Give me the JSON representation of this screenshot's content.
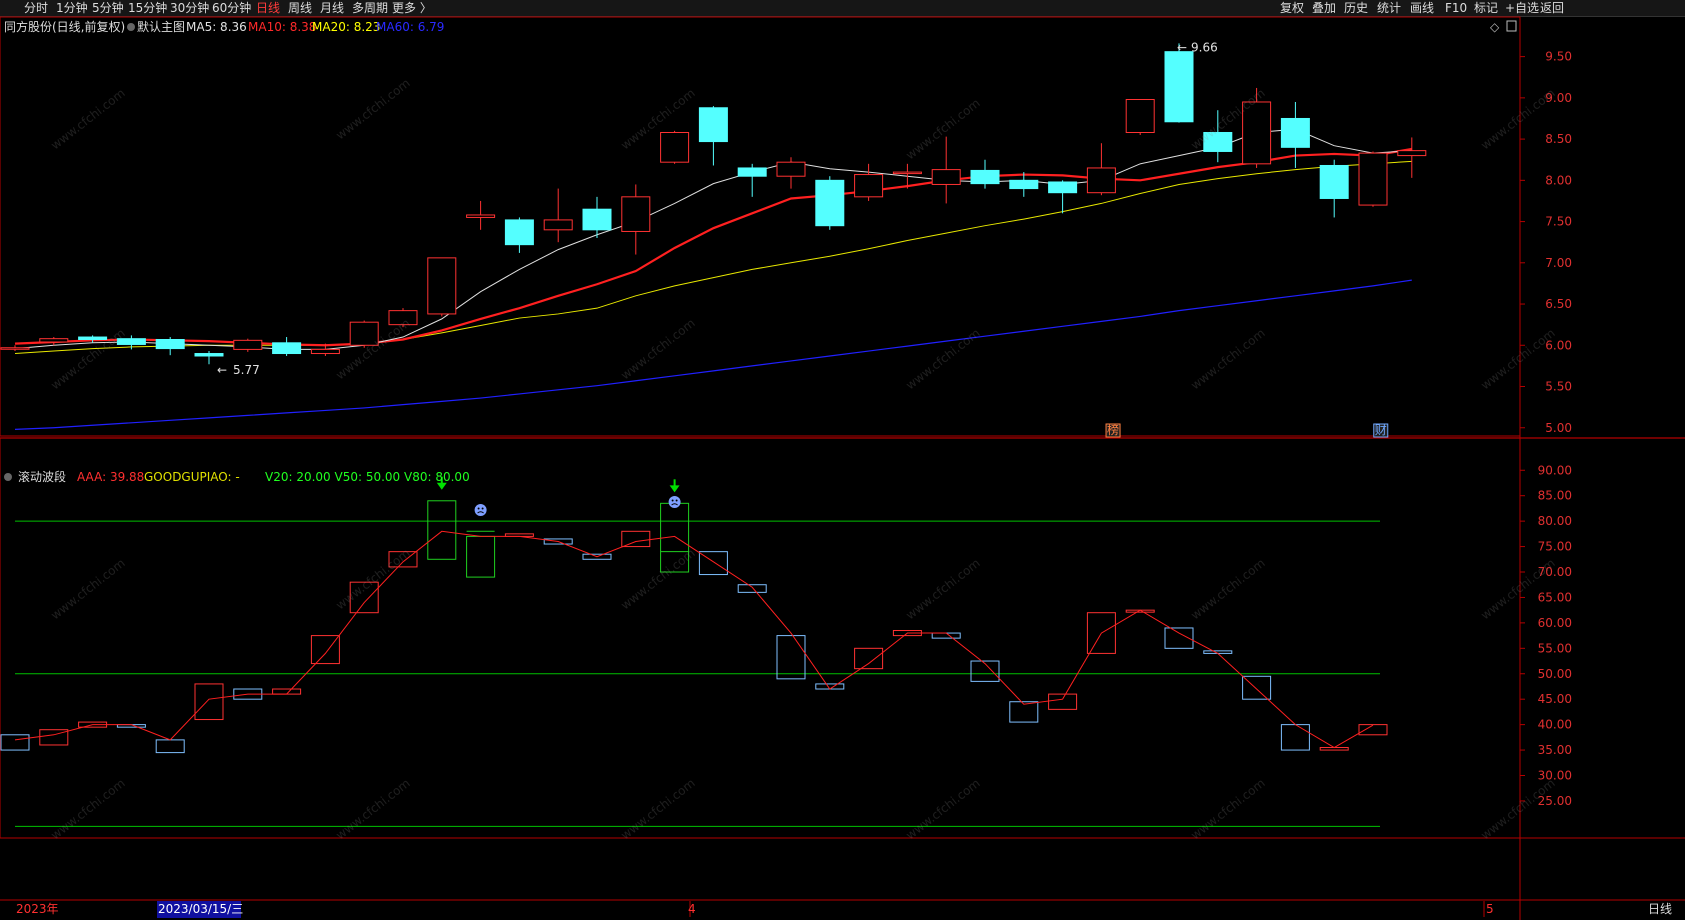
{
  "toolbar": {
    "left": [
      "分时",
      "1分钟",
      "5分钟",
      "15分钟",
      "30分钟",
      "60分钟",
      "日线",
      "周线",
      "月线",
      "多周期",
      "更多 〉"
    ],
    "active": "日线",
    "right": [
      "复权",
      "叠加",
      "历史",
      "统计",
      "画线",
      "F10",
      "+自选",
      "返回"
    ],
    "mark_label": "标记"
  },
  "main_legend": {
    "stock": "同方股份(日线,前复权)",
    "template": "默认主图",
    "ma5": "MA5: 8.36",
    "ma10": "MA10: 8.38",
    "ma20": "MA20: 8.23",
    "ma60": "MA60: 6.79"
  },
  "sub_legend": {
    "name": "滚动波段",
    "aaa": "AAA: 39.88",
    "goodgupiao": "GOODGUPIAO: -",
    "v": "V20: 20.00  V50: 50.00  V80: 80.00"
  },
  "annotations": {
    "high": "9.66",
    "low": "5.77",
    "event1": "榜",
    "event2": "财"
  },
  "bottom": {
    "year": "2023年",
    "cursor_date": "2023/03/15/三",
    "month4": "4",
    "month5": "5",
    "period": "日线"
  },
  "watermark": "www.cfchi.com",
  "colors": {
    "bg": "#000000",
    "up": "#ff3232",
    "down": "#54ffff",
    "ma5": "#e0e0e0",
    "ma10": "#ff2020",
    "ma20": "#e8e800",
    "ma60": "#2020ff",
    "axis": "#b40000",
    "green": "#00c000",
    "sub_down": "#7fbfff"
  },
  "chart_data": [
    {
      "type": "candlestick",
      "title": "同方股份(日线,前复权)",
      "ylim": [
        4.9,
        9.75
      ],
      "yticks": [
        5.0,
        5.5,
        6.0,
        6.5,
        7.0,
        7.5,
        8.0,
        8.5,
        9.0,
        9.5
      ],
      "candles": [
        {
          "o": 5.97,
          "c": 5.97,
          "h": 6.0,
          "l": 5.93
        },
        {
          "o": 6.04,
          "c": 6.08,
          "h": 6.1,
          "l": 6.0
        },
        {
          "o": 6.1,
          "c": 6.07,
          "h": 6.12,
          "l": 6.03
        },
        {
          "o": 6.08,
          "c": 6.01,
          "h": 6.12,
          "l": 5.95
        },
        {
          "o": 6.07,
          "c": 5.96,
          "h": 6.1,
          "l": 5.88
        },
        {
          "o": 5.9,
          "c": 5.87,
          "h": 5.93,
          "l": 5.77
        },
        {
          "o": 5.95,
          "c": 6.06,
          "h": 6.08,
          "l": 5.92
        },
        {
          "o": 6.03,
          "c": 5.9,
          "h": 6.1,
          "l": 5.87
        },
        {
          "o": 5.9,
          "c": 5.95,
          "h": 6.02,
          "l": 5.87
        },
        {
          "o": 6.0,
          "c": 6.28,
          "h": 6.3,
          "l": 5.97
        },
        {
          "o": 6.25,
          "c": 6.42,
          "h": 6.45,
          "l": 6.22
        },
        {
          "o": 6.38,
          "c": 7.06,
          "h": 7.06,
          "l": 6.35
        },
        {
          "o": 7.55,
          "c": 7.58,
          "h": 7.75,
          "l": 7.4
        },
        {
          "o": 7.52,
          "c": 7.22,
          "h": 7.55,
          "l": 7.12
        },
        {
          "o": 7.4,
          "c": 7.52,
          "h": 7.9,
          "l": 7.25
        },
        {
          "o": 7.65,
          "c": 7.4,
          "h": 7.8,
          "l": 7.3
        },
        {
          "o": 7.38,
          "c": 7.8,
          "h": 7.95,
          "l": 7.1
        },
        {
          "o": 8.22,
          "c": 8.58,
          "h": 8.6,
          "l": 8.2
        },
        {
          "o": 8.88,
          "c": 8.47,
          "h": 8.9,
          "l": 8.18
        },
        {
          "o": 8.15,
          "c": 8.05,
          "h": 8.2,
          "l": 7.8
        },
        {
          "o": 8.05,
          "c": 8.22,
          "h": 8.28,
          "l": 7.9
        },
        {
          "o": 8.0,
          "c": 7.45,
          "h": 8.05,
          "l": 7.4
        },
        {
          "o": 7.8,
          "c": 8.07,
          "h": 8.2,
          "l": 7.75
        },
        {
          "o": 8.1,
          "c": 8.1,
          "h": 8.2,
          "l": 7.9
        },
        {
          "o": 7.95,
          "c": 8.13,
          "h": 8.53,
          "l": 7.72
        },
        {
          "o": 8.12,
          "c": 7.96,
          "h": 8.25,
          "l": 7.9
        },
        {
          "o": 8.0,
          "c": 7.9,
          "h": 8.1,
          "l": 7.8
        },
        {
          "o": 7.98,
          "c": 7.85,
          "h": 8.0,
          "l": 7.6
        },
        {
          "o": 7.85,
          "c": 8.15,
          "h": 8.45,
          "l": 7.82
        },
        {
          "o": 8.58,
          "c": 8.98,
          "h": 8.98,
          "l": 8.55
        },
        {
          "o": 9.56,
          "c": 8.71,
          "h": 9.66,
          "l": 8.7
        },
        {
          "o": 8.58,
          "c": 8.35,
          "h": 8.85,
          "l": 8.22
        },
        {
          "o": 8.2,
          "c": 8.95,
          "h": 9.12,
          "l": 8.15
        },
        {
          "o": 8.75,
          "c": 8.4,
          "h": 8.95,
          "l": 8.15
        },
        {
          "o": 8.18,
          "c": 7.78,
          "h": 8.25,
          "l": 7.55
        },
        {
          "o": 7.7,
          "c": 8.33,
          "h": 8.35,
          "l": 7.68
        },
        {
          "o": 8.3,
          "c": 8.36,
          "h": 8.52,
          "l": 8.03
        }
      ],
      "ma5": [
        5.96,
        6.0,
        6.03,
        6.04,
        6.02,
        6.0,
        5.98,
        5.95,
        5.95,
        6.0,
        6.1,
        6.32,
        6.65,
        6.92,
        7.16,
        7.34,
        7.5,
        7.72,
        7.96,
        8.1,
        8.22,
        8.14,
        8.1,
        8.05,
        8.0,
        7.98,
        8.0,
        7.95,
        8.0,
        8.2,
        8.3,
        8.4,
        8.58,
        8.62,
        8.42,
        8.33,
        8.36
      ],
      "ma10": [
        6.02,
        6.04,
        6.06,
        6.07,
        6.06,
        6.05,
        6.03,
        6.01,
        6.0,
        6.02,
        6.07,
        6.18,
        6.32,
        6.45,
        6.6,
        6.74,
        6.9,
        7.18,
        7.42,
        7.6,
        7.78,
        7.82,
        7.87,
        7.93,
        8.0,
        8.05,
        8.07,
        8.06,
        8.02,
        8.0,
        8.08,
        8.16,
        8.22,
        8.3,
        8.32,
        8.3,
        8.38
      ],
      "ma20": [
        5.9,
        5.93,
        5.96,
        5.98,
        5.99,
        6.0,
        6.0,
        6.0,
        6.0,
        6.02,
        6.07,
        6.15,
        6.24,
        6.33,
        6.38,
        6.45,
        6.6,
        6.72,
        6.82,
        6.92,
        7.0,
        7.08,
        7.17,
        7.27,
        7.36,
        7.45,
        7.53,
        7.62,
        7.72,
        7.84,
        7.95,
        8.02,
        8.08,
        8.13,
        8.17,
        8.2,
        8.23
      ],
      "ma60": [
        4.98,
        5.0,
        5.03,
        5.06,
        5.09,
        5.12,
        5.15,
        5.18,
        5.21,
        5.24,
        5.28,
        5.32,
        5.36,
        5.41,
        5.46,
        5.51,
        5.57,
        5.63,
        5.69,
        5.75,
        5.81,
        5.87,
        5.93,
        5.99,
        6.05,
        6.11,
        6.17,
        6.23,
        6.29,
        6.35,
        6.42,
        6.48,
        6.54,
        6.6,
        6.66,
        6.72,
        6.79
      ]
    },
    {
      "type": "candlestick",
      "title": "滚动波段",
      "ylim": [
        18.5,
        93.0
      ],
      "yticks": [
        25,
        30,
        35,
        40,
        45,
        50,
        55,
        60,
        65,
        70,
        75,
        80,
        85,
        90
      ],
      "hlines": [
        20,
        50,
        80
      ],
      "bars": [
        {
          "o": 38.0,
          "c": 35.0,
          "k": "down"
        },
        {
          "o": 36.0,
          "c": 39.0,
          "k": "up"
        },
        {
          "o": 39.5,
          "c": 40.5,
          "k": "up"
        },
        {
          "o": 40.0,
          "c": 39.5,
          "k": "down"
        },
        {
          "o": 37.0,
          "c": 34.5,
          "k": "down"
        },
        {
          "o": 41.0,
          "c": 48.0,
          "k": "up"
        },
        {
          "o": 47.0,
          "c": 45.0,
          "k": "down"
        },
        {
          "o": 46.0,
          "c": 47.0,
          "k": "up"
        },
        {
          "o": 52.0,
          "c": 57.5,
          "k": "up"
        },
        {
          "o": 62.0,
          "c": 68.0,
          "k": "up"
        },
        {
          "o": 71.0,
          "c": 74.0,
          "k": "up"
        },
        {
          "o": 72.5,
          "c": 84.0,
          "k": "green"
        },
        {
          "o": 77.0,
          "c": 69.0,
          "k": "green",
          "mark": 78.0
        },
        {
          "o": 77.0,
          "c": 77.5,
          "k": "up"
        },
        {
          "o": 76.5,
          "c": 75.5,
          "k": "down"
        },
        {
          "o": 73.5,
          "c": 72.5,
          "k": "down"
        },
        {
          "o": 75.0,
          "c": 78.0,
          "k": "up"
        },
        {
          "o": 70.0,
          "c": 83.5,
          "k": "green",
          "mark": 74.0
        },
        {
          "o": 74.0,
          "c": 69.5,
          "k": "down"
        },
        {
          "o": 67.5,
          "c": 66.0,
          "k": "down"
        },
        {
          "o": 57.5,
          "c": 49.0,
          "k": "down"
        },
        {
          "o": 48.0,
          "c": 47.0,
          "k": "down"
        },
        {
          "o": 51.0,
          "c": 55.0,
          "k": "up"
        },
        {
          "o": 57.5,
          "c": 58.5,
          "k": "up"
        },
        {
          "o": 58.0,
          "c": 57.0,
          "k": "down"
        },
        {
          "o": 52.5,
          "c": 48.5,
          "k": "down"
        },
        {
          "o": 44.5,
          "c": 40.5,
          "k": "down"
        },
        {
          "o": 43.0,
          "c": 46.0,
          "k": "up"
        },
        {
          "o": 54.0,
          "c": 62.0,
          "k": "up"
        },
        {
          "o": 62.5,
          "c": 62.5,
          "k": "up"
        },
        {
          "o": 59.0,
          "c": 55.0,
          "k": "down"
        },
        {
          "o": 54.5,
          "c": 54.0,
          "k": "down"
        },
        {
          "o": 49.5,
          "c": 45.0,
          "k": "down"
        },
        {
          "o": 40.0,
          "c": 35.0,
          "k": "down"
        },
        {
          "o": 35.0,
          "c": 35.5,
          "k": "up"
        },
        {
          "o": 38.0,
          "c": 40.0,
          "k": "up"
        }
      ],
      "aaa_line": [
        37,
        38,
        40,
        40,
        37,
        45,
        46,
        46,
        54,
        64,
        72,
        78,
        77,
        77,
        76,
        73,
        76,
        77,
        72,
        67,
        58,
        47,
        52,
        58,
        58,
        52,
        44,
        45,
        58,
        62.5,
        58,
        54,
        47,
        40,
        35.5,
        39.88
      ],
      "signal_arrows": [
        11,
        17
      ],
      "face_icons": [
        12,
        17
      ]
    }
  ]
}
